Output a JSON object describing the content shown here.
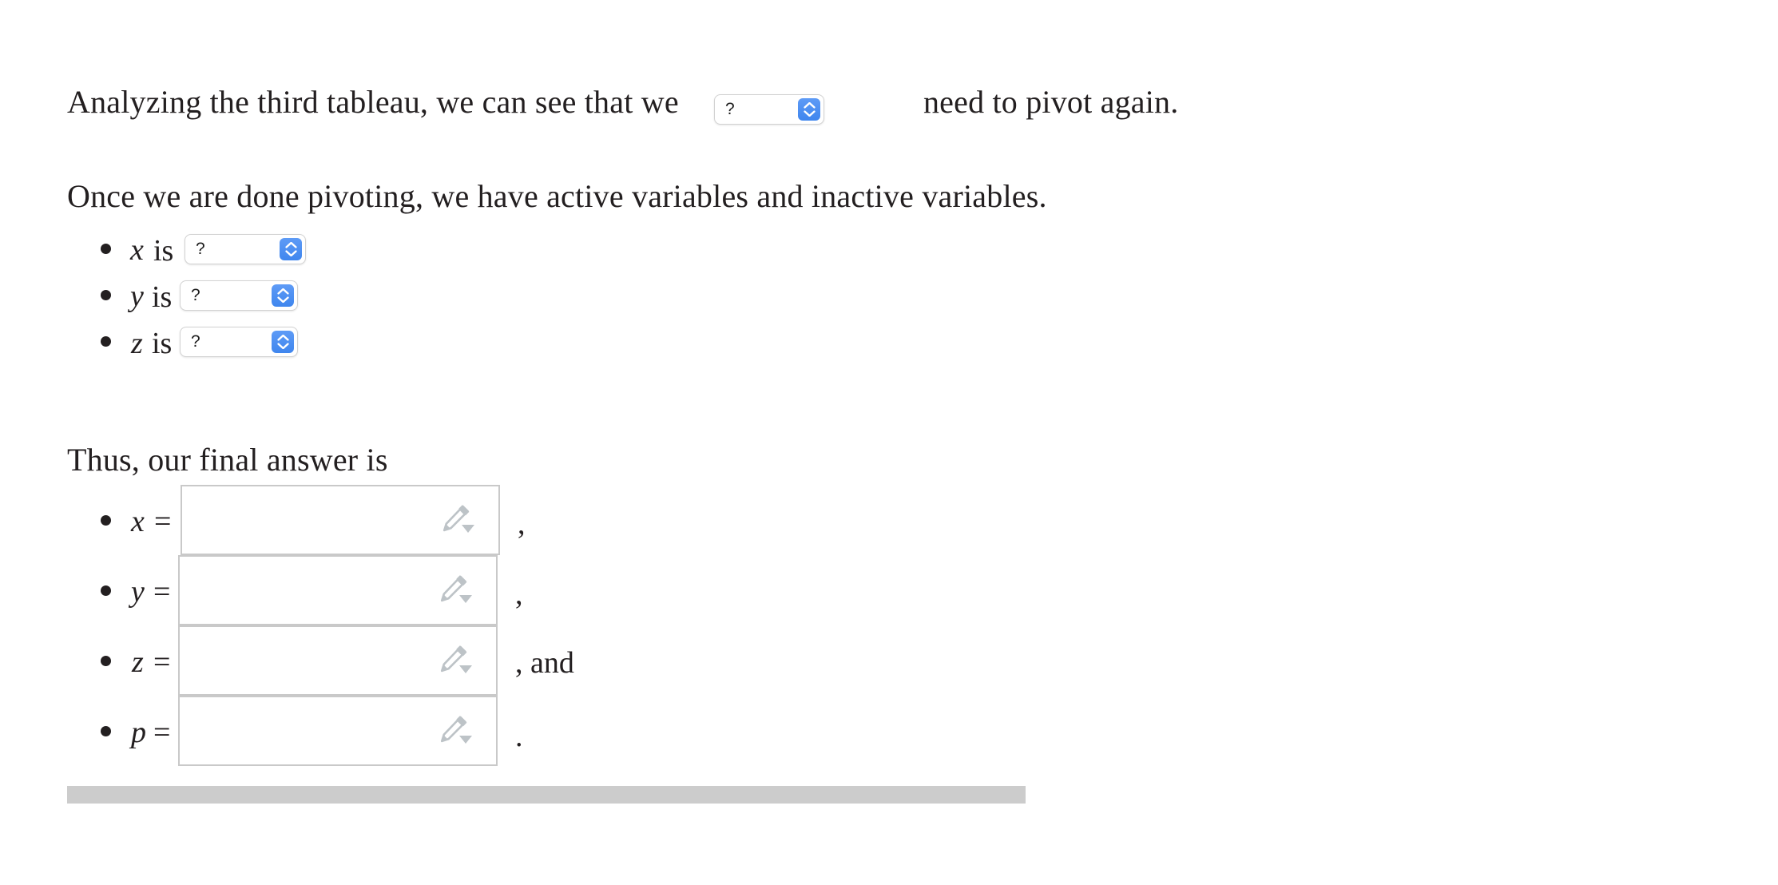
{
  "document": {
    "paragraph_one": {
      "before_select": "Analyzing the third tableau, we can see that we",
      "after_select": "need to pivot again."
    },
    "paragraph_two": "Once we are done pivoting, we have active variables and inactive variables.",
    "paragraph_three": "Thus, our final answer is"
  },
  "selects": {
    "pivot": {
      "value": "?",
      "name": "pivot-again-select",
      "stepper_icon": "chevron-up-down-icon"
    },
    "x": {
      "variable": "x",
      "connector": "is",
      "value": "?"
    },
    "y": {
      "variable": "y",
      "connector": "is",
      "value": "?"
    },
    "z": {
      "variable": "z",
      "connector": "is",
      "value": "?"
    }
  },
  "answers": [
    {
      "variable": "x",
      "operator": "=",
      "value": "",
      "trailer": ",",
      "editor_icon": "pencil-dropdown-icon"
    },
    {
      "variable": "y",
      "operator": "=",
      "value": "",
      "trailer": ",",
      "editor_icon": "pencil-dropdown-icon"
    },
    {
      "variable": "z",
      "operator": "=",
      "value": "",
      "trailer": ", and",
      "editor_icon": "pencil-dropdown-icon"
    },
    {
      "variable": "p",
      "operator": "=",
      "value": "",
      "trailer": ".",
      "editor_icon": "pencil-dropdown-icon"
    }
  ],
  "scrollbar": {
    "orientation": "horizontal",
    "thumb_color": "#cccccc"
  },
  "colors": {
    "text": "#231f20",
    "stepper_blue": "#4a8ef0",
    "box_border": "#c9c9c9",
    "pencil_gray": "#bdc3c7",
    "scrollbar": "#cccccc"
  }
}
